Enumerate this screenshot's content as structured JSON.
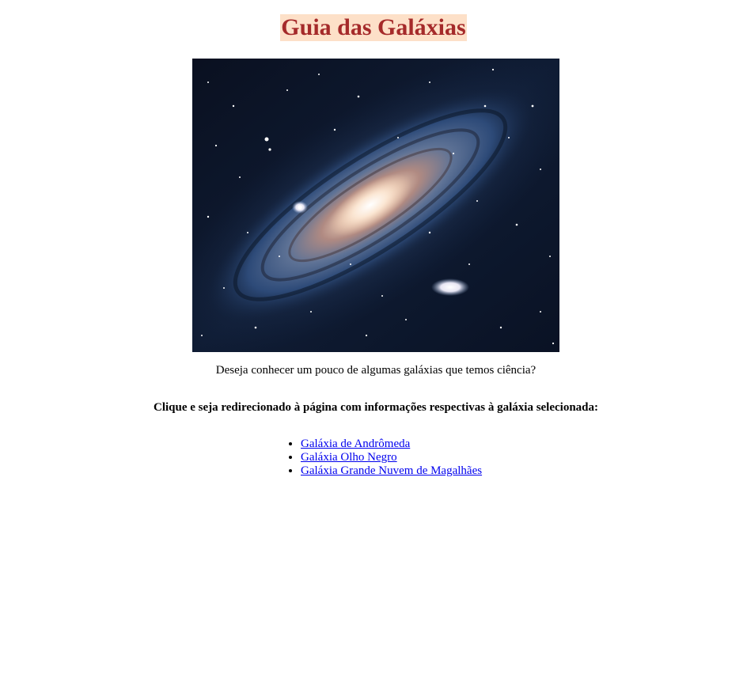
{
  "page": {
    "title": "Guia das Galáxias",
    "question": "Deseja conhecer um pouco de algumas galáxias que temos ciência?",
    "instruction": "Clique e seja redirecionado à página com informações respectivas à galáxia selecionada:"
  },
  "links": [
    {
      "label": "Galáxia de Andrômeda"
    },
    {
      "label": "Galáxia Olho Negro"
    },
    {
      "label": "Galáxia Grande Nuvem de Magalhães"
    }
  ],
  "colors": {
    "title_text": "#a52a2a",
    "title_background": "#fde0c8",
    "link": "#0000ee"
  }
}
